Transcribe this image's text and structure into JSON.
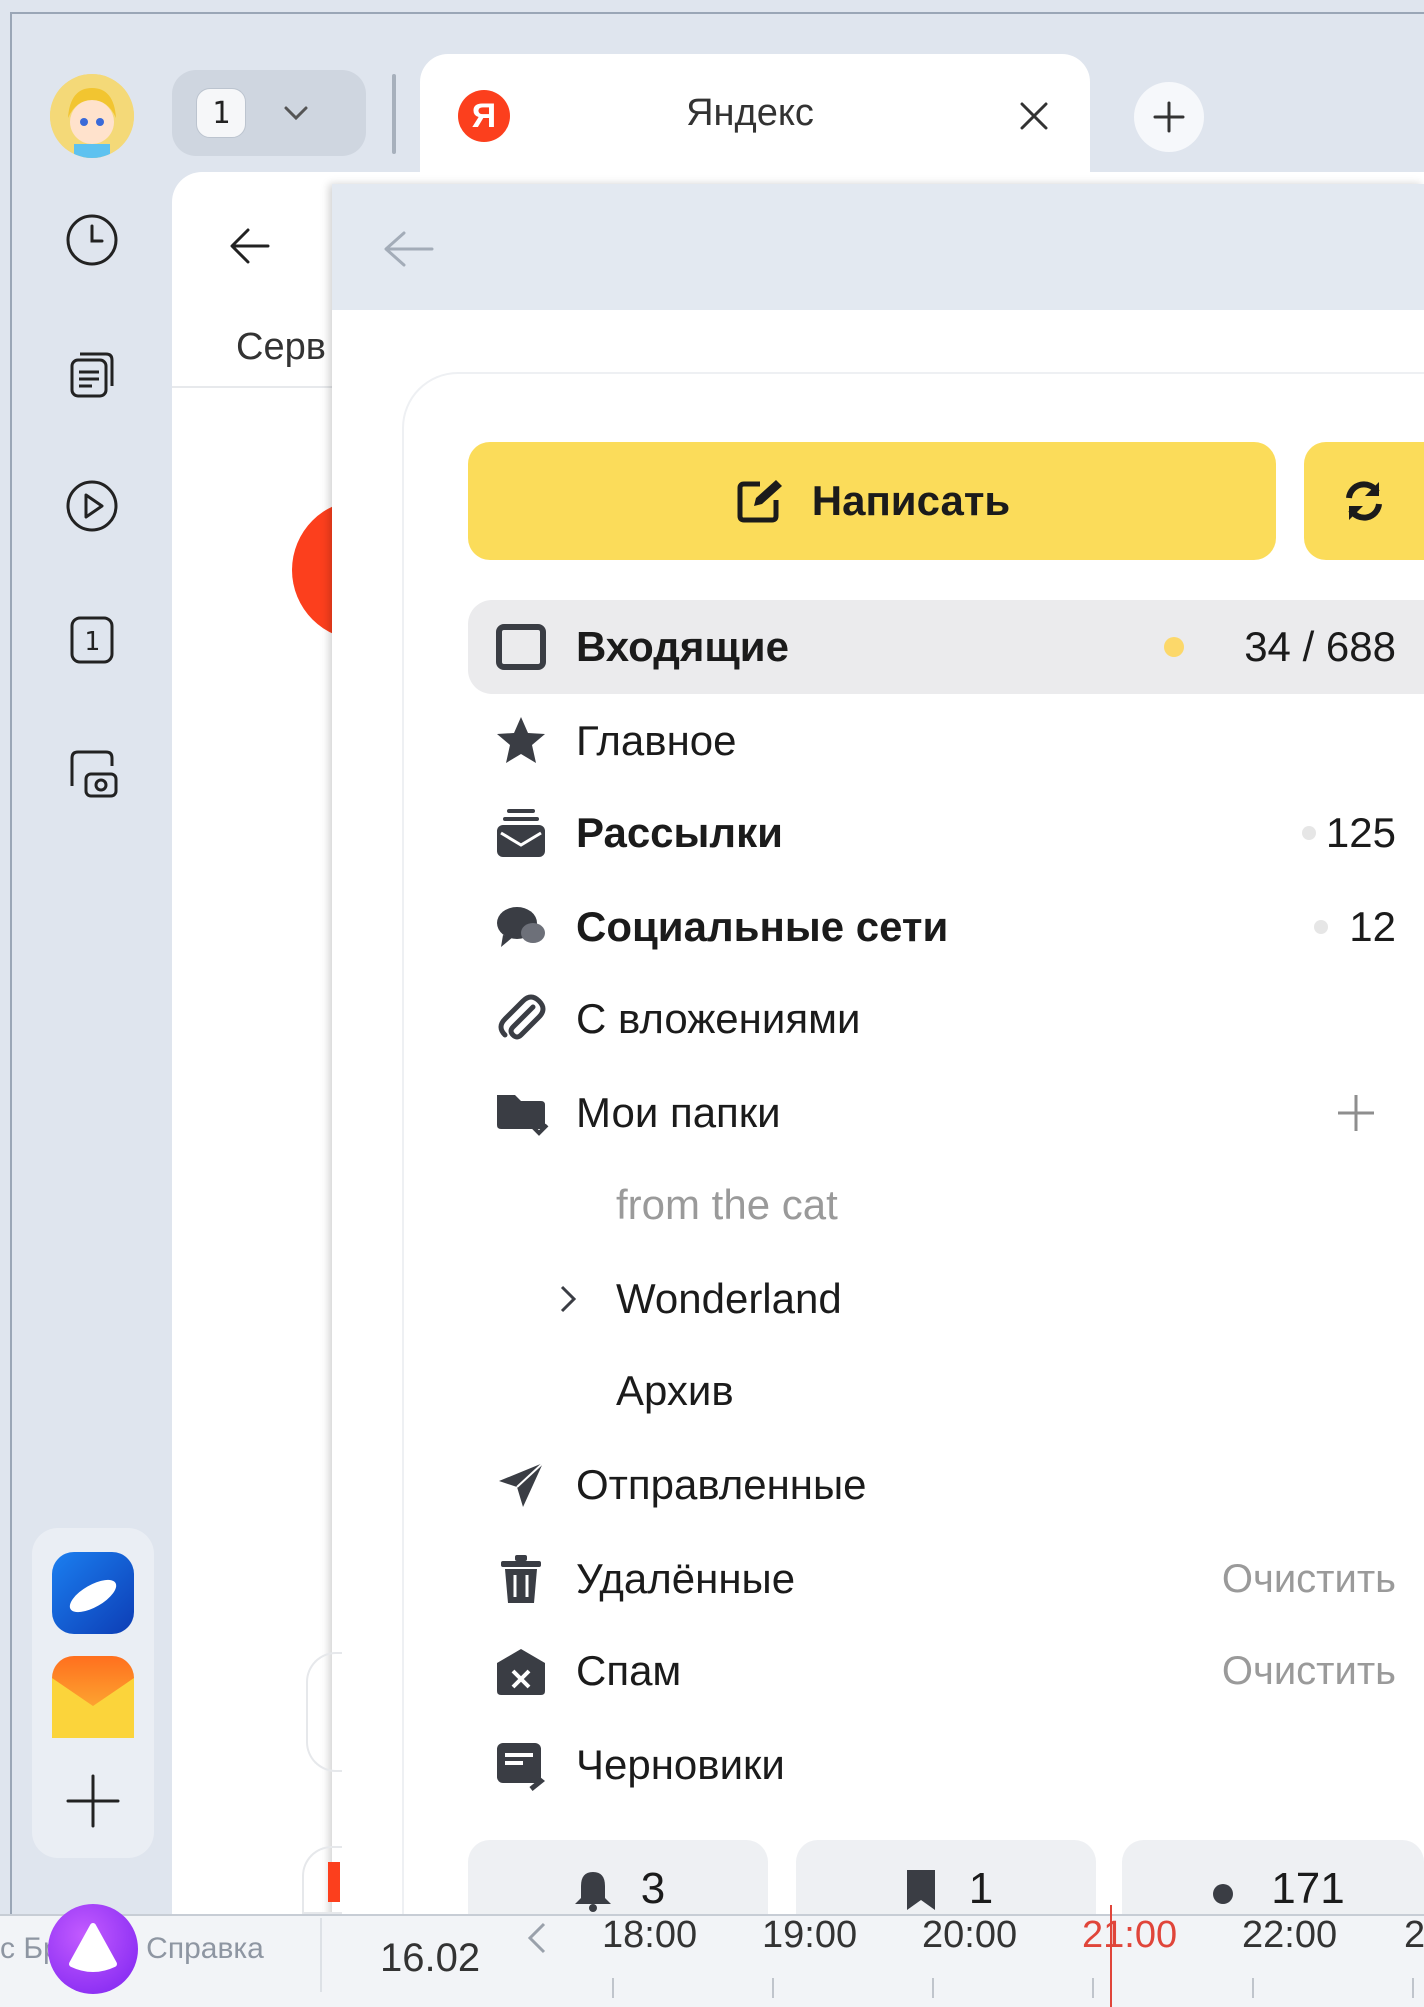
{
  "browser": {
    "tab_count": "1",
    "active_tab_title": "Яндекс",
    "active_tab_logo": "Я"
  },
  "page": {
    "services_label_partial": "Серв"
  },
  "mail": {
    "compose_label": "Написать",
    "folders": [
      {
        "icon": "inbox-icon",
        "label": "Входящие",
        "count": "34 / 688",
        "bold": true,
        "active": true
      },
      {
        "icon": "star-icon",
        "label": "Главное",
        "count": ""
      },
      {
        "icon": "newsletter-icon",
        "label": "Рассылки",
        "count": "125",
        "bold": true
      },
      {
        "icon": "chat-icon",
        "label": "Социальные сети",
        "count": "12",
        "bold": true
      },
      {
        "icon": "paperclip-icon",
        "label": "С вложениями",
        "count": ""
      },
      {
        "icon": "folder-icon",
        "label": "Мои папки",
        "count": ""
      },
      {
        "label": "from the cat",
        "dimmed": true
      },
      {
        "label": "Wonderland"
      },
      {
        "label": "Архив"
      },
      {
        "icon": "paper-plane-icon",
        "label": "Отправленные"
      },
      {
        "icon": "trash-icon",
        "label": "Удалённые",
        "action": "Очистить"
      },
      {
        "icon": "spam-icon",
        "label": "Спам",
        "action": "Очистить"
      },
      {
        "icon": "draft-icon",
        "label": "Черновики"
      }
    ],
    "tiles": [
      {
        "icon": "bell-icon",
        "value": "3"
      },
      {
        "icon": "bookmark-icon",
        "value": "1"
      },
      {
        "icon": "dot-icon",
        "value": "171"
      }
    ],
    "accent_color": "#fbdc5a",
    "unread_dot_color": "#fcd86a"
  },
  "timeline": {
    "date": "16.02",
    "hours": [
      "18:00",
      "19:00",
      "20:00",
      "21:00",
      "22:00",
      "2"
    ],
    "current_hour": "21:00"
  },
  "footer": {
    "links_text": "с Браузер   Справка"
  }
}
